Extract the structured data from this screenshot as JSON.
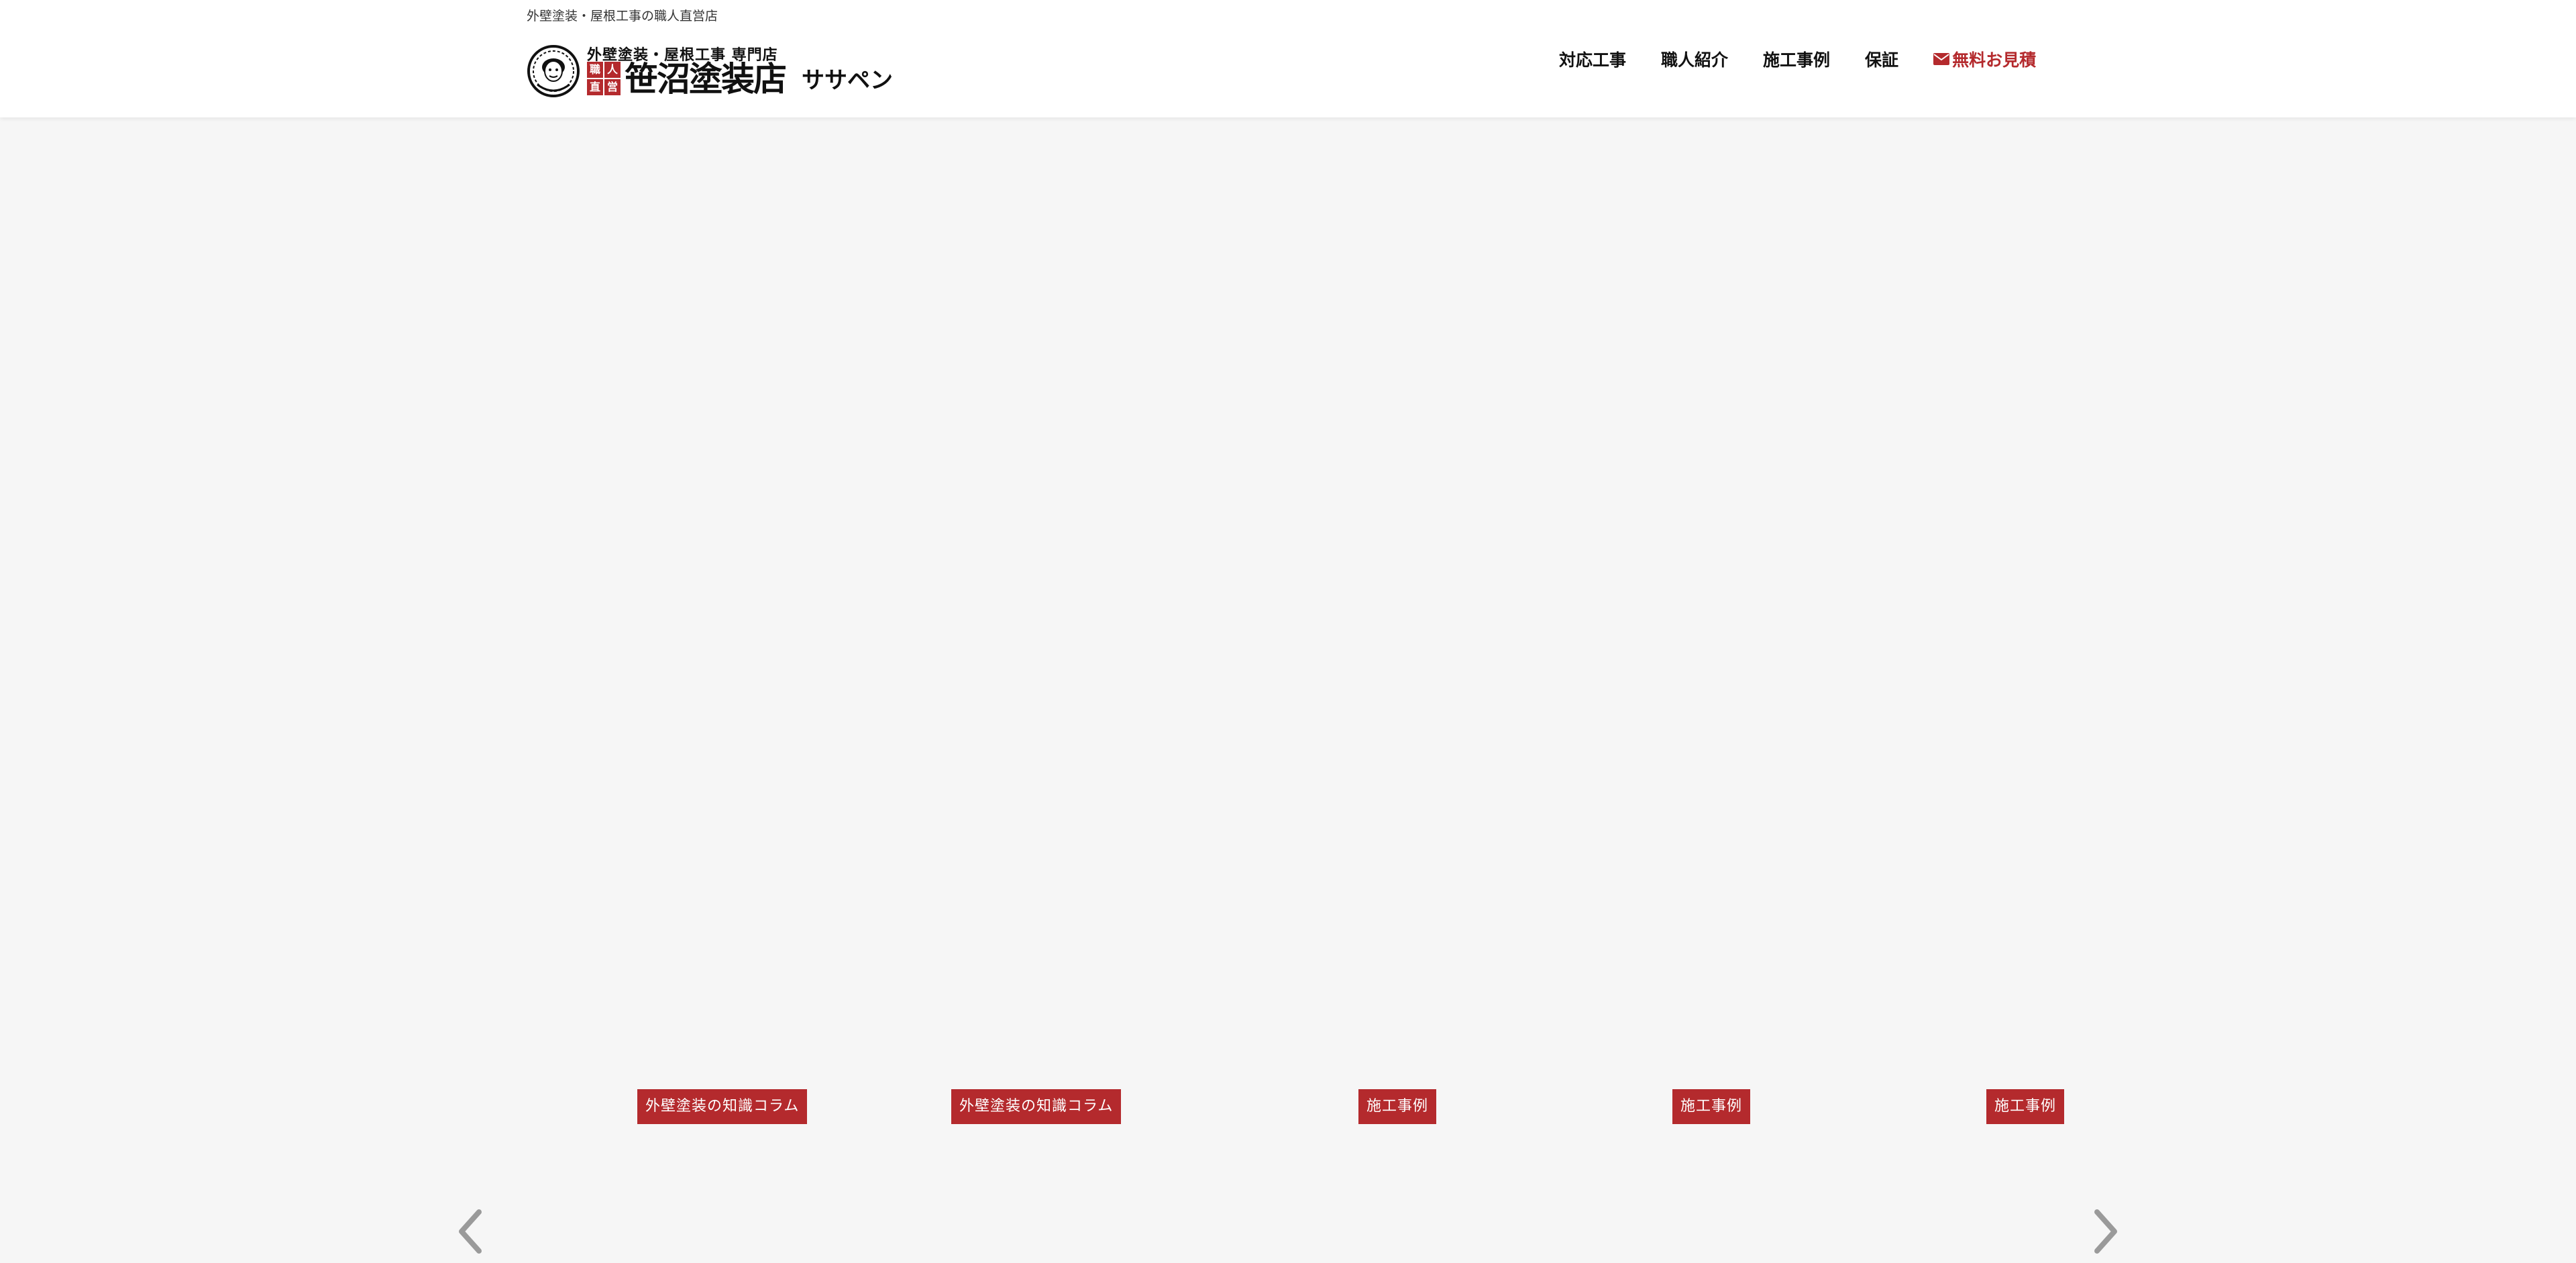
{
  "header": {
    "tagline": "外壁塗装・屋根工事の職人直営店",
    "logo": {
      "subtitle": "外壁塗装・屋根工事 専門店",
      "stamp": [
        "職",
        "人",
        "直",
        "営"
      ],
      "name": "笹沼塗装店",
      "kana": "ササペン"
    },
    "nav": {
      "items": [
        {
          "label": "対応工事"
        },
        {
          "label": "職人紹介"
        },
        {
          "label": "施工事例"
        },
        {
          "label": "保証"
        }
      ],
      "cta": {
        "label": "無料お見積",
        "icon": "envelope-icon"
      }
    }
  },
  "slider": {
    "cards": [
      {
        "category": "外壁塗装の知識コラム"
      },
      {
        "category": "外壁塗装の知識コラム"
      },
      {
        "category": "施工事例"
      },
      {
        "category": "施工事例"
      },
      {
        "category": "施工事例"
      }
    ],
    "prev_icon": "chevron-left-icon",
    "next_icon": "chevron-right-icon"
  },
  "colors": {
    "accent": "#b42a2d",
    "background": "#f6f6f6",
    "header_bg": "#ffffff",
    "arrow": "#9a9a9a"
  }
}
